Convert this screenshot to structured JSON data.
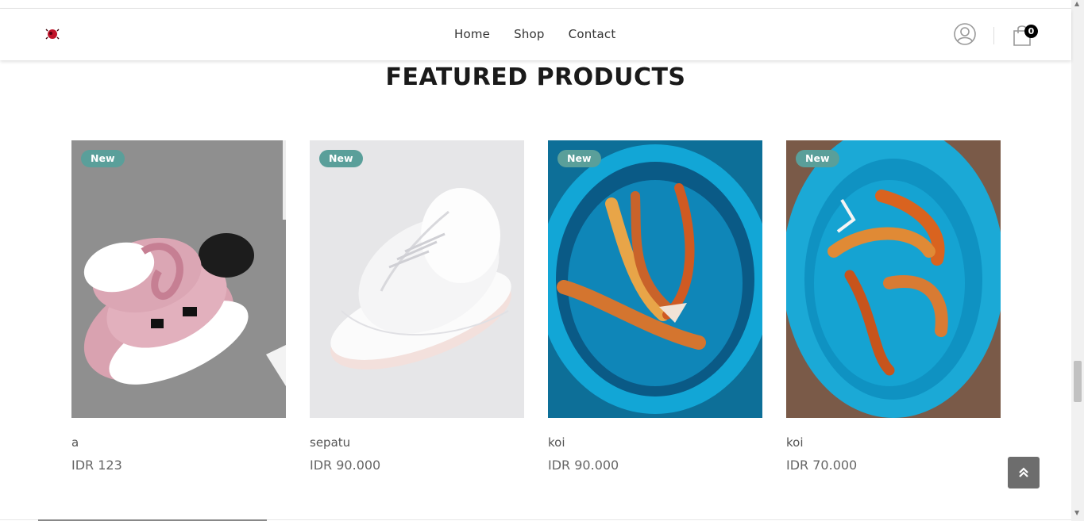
{
  "header": {
    "nav": [
      "Home",
      "Shop",
      "Contact"
    ],
    "cart_count": "0"
  },
  "section_title": "FEATURED PRODUCTS",
  "products": [
    {
      "badge": "New",
      "name": "a",
      "price": "IDR 123"
    },
    {
      "badge": "New",
      "name": "sepatu",
      "price": "IDR 90.000"
    },
    {
      "badge": "New",
      "name": "koi",
      "price": "IDR 90.000"
    },
    {
      "badge": "New",
      "name": "koi",
      "price": "IDR 70.000"
    }
  ],
  "colors": {
    "badge": "#5a9f9a",
    "back_to_top": "#6d6d6d"
  }
}
